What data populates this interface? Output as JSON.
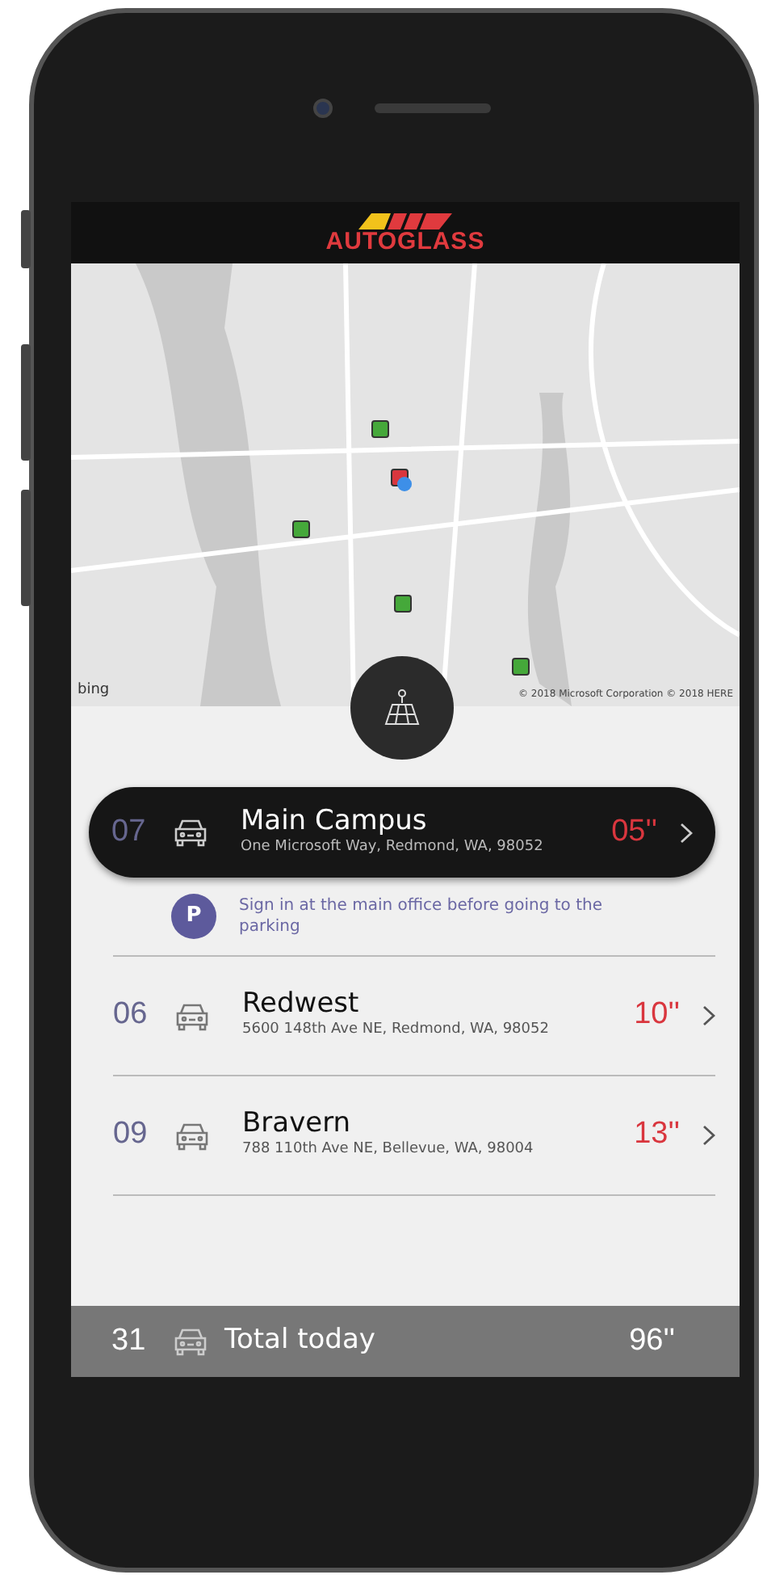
{
  "header": {
    "logo_text": "AUTOGLASS"
  },
  "map": {
    "pins": [
      {
        "color": "#45a83a"
      },
      {
        "color": "#d9363e"
      },
      {
        "color": "#45a83a"
      },
      {
        "color": "#45a83a"
      },
      {
        "color": "#45a83a"
      }
    ],
    "provider": "bing",
    "attribution": "© 2018 Microsoft Corporation © 2018 HERE"
  },
  "stops": [
    {
      "number": "07",
      "name": "Main Campus",
      "address": "One Microsoft Way, Redmond, WA, 98052",
      "time": "05''",
      "selected": true,
      "note": {
        "icon_text": "P",
        "text": "Sign in at the main office before going to the parking"
      }
    },
    {
      "number": "06",
      "name": "Redwest",
      "address": "5600 148th Ave NE, Redmond, WA, 98052",
      "time": "10''",
      "selected": false
    },
    {
      "number": "09",
      "name": "Bravern",
      "address": "788 110th Ave NE, Bellevue, WA, 98004",
      "time": "13''",
      "selected": false
    }
  ],
  "total": {
    "count": "31",
    "label": "Total today",
    "time": "96''"
  }
}
